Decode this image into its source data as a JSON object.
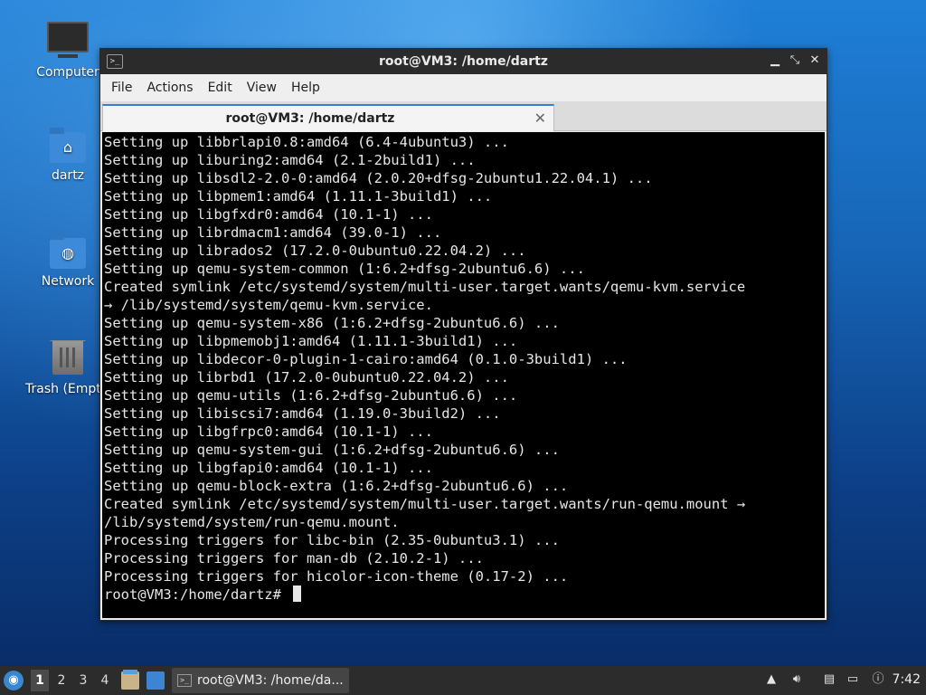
{
  "desktop": {
    "icons": [
      {
        "label": "Computer"
      },
      {
        "label": "dartz"
      },
      {
        "label": "Network"
      },
      {
        "label": "Trash (Empty)"
      }
    ]
  },
  "window": {
    "title": "root@VM3: /home/dartz",
    "menu": [
      "File",
      "Actions",
      "Edit",
      "View",
      "Help"
    ],
    "tab_label": "root@VM3: /home/dartz",
    "terminal_lines": [
      "Setting up libbrlapi0.8:amd64 (6.4-4ubuntu3) ...",
      "Setting up liburing2:amd64 (2.1-2build1) ...",
      "Setting up libsdl2-2.0-0:amd64 (2.0.20+dfsg-2ubuntu1.22.04.1) ...",
      "Setting up libpmem1:amd64 (1.11.1-3build1) ...",
      "Setting up libgfxdr0:amd64 (10.1-1) ...",
      "Setting up librdmacm1:amd64 (39.0-1) ...",
      "Setting up librados2 (17.2.0-0ubuntu0.22.04.2) ...",
      "Setting up qemu-system-common (1:6.2+dfsg-2ubuntu6.6) ...",
      "Created symlink /etc/systemd/system/multi-user.target.wants/qemu-kvm.service",
      "→ /lib/systemd/system/qemu-kvm.service.",
      "Setting up qemu-system-x86 (1:6.2+dfsg-2ubuntu6.6) ...",
      "Setting up libpmemobj1:amd64 (1.11.1-3build1) ...",
      "Setting up libdecor-0-plugin-1-cairo:amd64 (0.1.0-3build1) ...",
      "Setting up librbd1 (17.2.0-0ubuntu0.22.04.2) ...",
      "Setting up qemu-utils (1:6.2+dfsg-2ubuntu6.6) ...",
      "Setting up libiscsi7:amd64 (1.19.0-3build2) ...",
      "Setting up libgfrpc0:amd64 (10.1-1) ...",
      "Setting up qemu-system-gui (1:6.2+dfsg-2ubuntu6.6) ...",
      "Setting up libgfapi0:amd64 (10.1-1) ...",
      "Setting up qemu-block-extra (1:6.2+dfsg-2ubuntu6.6) ...",
      "Created symlink /etc/systemd/system/multi-user.target.wants/run-qemu.mount →",
      "/lib/systemd/system/run-qemu.mount.",
      "Processing triggers for libc-bin (2.35-0ubuntu3.1) ...",
      "Processing triggers for man-db (2.10.2-1) ...",
      "Processing triggers for hicolor-icon-theme (0.17-2) ..."
    ],
    "prompt": "root@VM3:/home/dartz# "
  },
  "taskbar": {
    "workspaces": [
      "1",
      "2",
      "3",
      "4"
    ],
    "active_workspace": "1",
    "task_label": "root@VM3: /home/da...",
    "clock": "7:42"
  }
}
